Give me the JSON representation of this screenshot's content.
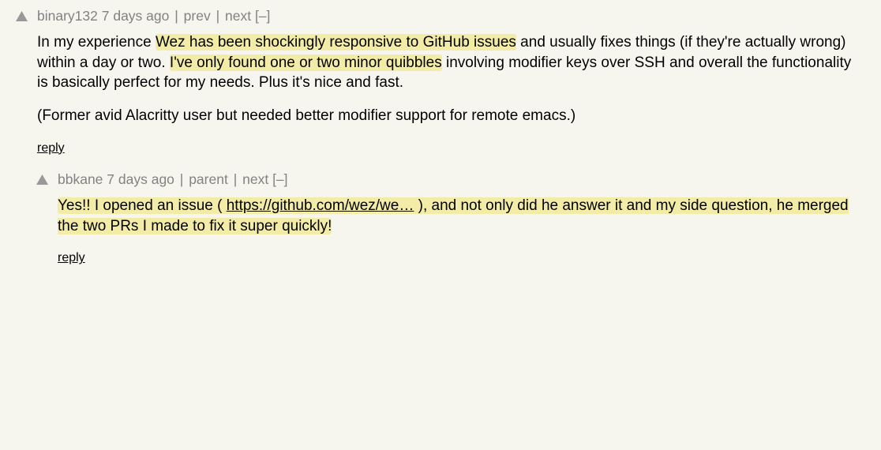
{
  "labels": {
    "prev": "prev",
    "next": "next",
    "parent": "parent",
    "collapse": "[–]",
    "reply": "reply",
    "pipe": " | "
  },
  "comments": [
    {
      "author": "binary132",
      "age": "7 days ago",
      "body": {
        "p1_a": "In my experience ",
        "p1_hl1": "Wez has been shockingly responsive to GitHub issues",
        "p1_b": " and usually fixes things (if they're actually wrong) within a day or two. ",
        "p1_hl2": "I've only found one or two minor quibbles",
        "p1_c": " involving modifier keys over SSH and overall the functionality is basically perfect for my needs. Plus it's nice and fast.",
        "p2": "(Former avid Alacritty user but needed better modifier support for remote emacs.)"
      }
    },
    {
      "author": "bbkane",
      "age": "7 days ago",
      "body": {
        "hl_a": "Yes!! I opened an issue ( ",
        "link": "https://github.com/wez/we…",
        "hl_b": " ), and not only did he answer it and my side question, he merged the two PRs I made to fix it super quickly!"
      }
    }
  ]
}
